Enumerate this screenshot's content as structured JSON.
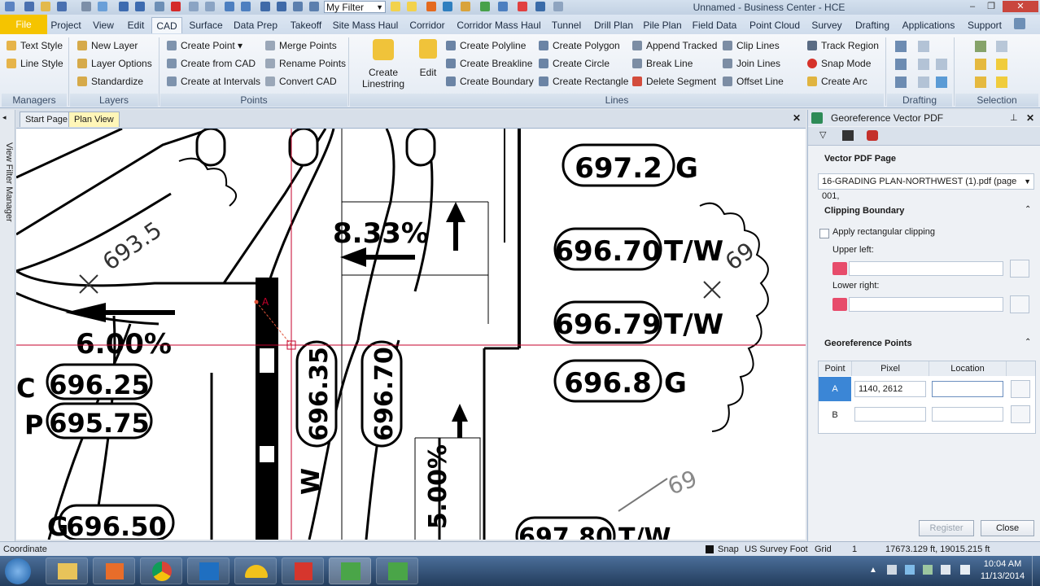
{
  "titlebar": {
    "filter_value": "My Filter",
    "title": "Unnamed - Business Center - HCE",
    "window_buttons": [
      "–",
      "❐",
      "✕"
    ]
  },
  "ribbon_tabs": [
    "File",
    "Project",
    "View",
    "Edit",
    "CAD",
    "Surface",
    "Data Prep",
    "Takeoff",
    "Site Mass Haul",
    "Corridor",
    "Corridor Mass Haul",
    "Tunnel",
    "Drill Plan",
    "Pile Plan",
    "Field Data",
    "Point Cloud",
    "Survey",
    "Drafting",
    "Applications",
    "Support"
  ],
  "ribbon": {
    "managers": [
      "Text Style",
      "Line Style"
    ],
    "layers": [
      "New Layer",
      "Layer Options",
      "Standardize"
    ],
    "points_a": [
      "Create Point",
      "Create from CAD",
      "Create at Intervals"
    ],
    "points_b": [
      "Merge Points",
      "Rename Points",
      "Convert CAD"
    ],
    "create_linestring": "Create Linestring",
    "edit": "Edit",
    "lines_a": [
      "Create Polyline",
      "Create Breakline",
      "Create Boundary"
    ],
    "lines_b": [
      "Create Polygon",
      "Create Circle",
      "Create Rectangle"
    ],
    "lines_c": [
      "Append Tracked",
      "Break Line",
      "Delete Segment"
    ],
    "lines_d": [
      "Clip Lines",
      "Join Lines",
      "Offset Line"
    ],
    "lines_e": [
      "Track Region",
      "Snap Mode",
      "Create Arc"
    ],
    "groups": [
      "Managers",
      "Layers",
      "Points",
      "Lines",
      "Drafting",
      "Selection"
    ]
  },
  "doc_tabs": [
    "Start Page",
    "Plan View"
  ],
  "left_rail_label": "View Filter Manager",
  "drawing": {
    "labels": [
      "697.2",
      "G",
      "8.33%",
      "696.70",
      "T/W",
      "696.79",
      "T/W",
      "696.8",
      "G",
      "6.00%",
      "696.25",
      "695.75",
      "696.35",
      "696.70",
      "5.00%",
      "696.50",
      "697.80",
      "T/W",
      "693.5",
      "69",
      "69",
      "A",
      "C",
      "P",
      "G",
      "W"
    ]
  },
  "panel": {
    "title": "Georeference Vector PDF",
    "vector_pdf_page_heading": "Vector PDF Page",
    "pdf_selected": "16-GRADING PLAN-NORTHWEST (1).pdf  (page 001,",
    "clipping_heading": "Clipping Boundary",
    "apply_clipping": "Apply rectangular clipping",
    "upper_left": "Upper left:",
    "lower_right": "Lower right:",
    "georef_heading": "Georeference Points",
    "columns": [
      "Point",
      "Pixel",
      "Location"
    ],
    "rows": [
      {
        "point": "A",
        "pixel": "1140, 2612",
        "location": ""
      },
      {
        "point": "B",
        "pixel": "",
        "location": ""
      }
    ],
    "register": "Register",
    "close": "Close"
  },
  "statusbar": {
    "left": "Coordinate",
    "snap": "Snap",
    "units": "US Survey  Foot",
    "grid": "Grid",
    "grid_value": "1",
    "coords": "17673.129 ft, 19015.215 ft"
  },
  "taskbar": {
    "time": "10:04 AM",
    "date": "11/13/2014"
  },
  "colors": {
    "accent_file": "#f5c400",
    "crosshair": "#c4002b",
    "selected_cell": "#3b86d6"
  }
}
